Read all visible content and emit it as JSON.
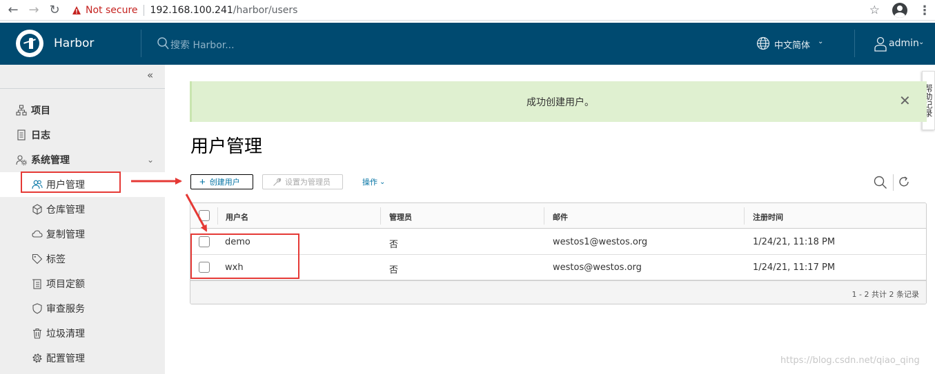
{
  "browser": {
    "not_secure": "Not secure",
    "url_host": "192.168.100.241",
    "url_path": "/harbor/users"
  },
  "header": {
    "app_name": "Harbor",
    "search_placeholder": "搜索 Harbor...",
    "language": "中文简体",
    "user": "admin"
  },
  "sidebar": {
    "items": [
      {
        "label": "项目"
      },
      {
        "label": "日志"
      },
      {
        "label": "系统管理"
      },
      {
        "label": "用户管理"
      },
      {
        "label": "仓库管理"
      },
      {
        "label": "复制管理"
      },
      {
        "label": "标签"
      },
      {
        "label": "项目定额"
      },
      {
        "label": "审查服务"
      },
      {
        "label": "垃圾清理"
      },
      {
        "label": "配置管理"
      }
    ]
  },
  "side_tab": "帮助记录",
  "alert": {
    "message": "成功创建用户。"
  },
  "page": {
    "title": "用户管理"
  },
  "toolbar": {
    "create_user": "创建用户",
    "set_admin": "设置为管理员",
    "actions": "操作"
  },
  "table": {
    "headers": [
      "用户名",
      "管理员",
      "邮件",
      "注册时间"
    ],
    "rows": [
      {
        "username": "demo",
        "admin": "否",
        "email": "westos1@westos.org",
        "registered": "1/24/21, 11:18 PM"
      },
      {
        "username": "wxh",
        "admin": "否",
        "email": "westos@westos.org",
        "registered": "1/24/21, 11:17 PM"
      }
    ],
    "footer": "1 - 2 共计 2 条记录"
  },
  "watermark": "https://blog.csdn.net/qiao_qing",
  "colors": {
    "header_bg": "#004a70",
    "alert_bg": "#dff0d0",
    "link": "#0072a3",
    "annotation": "#e53935"
  }
}
